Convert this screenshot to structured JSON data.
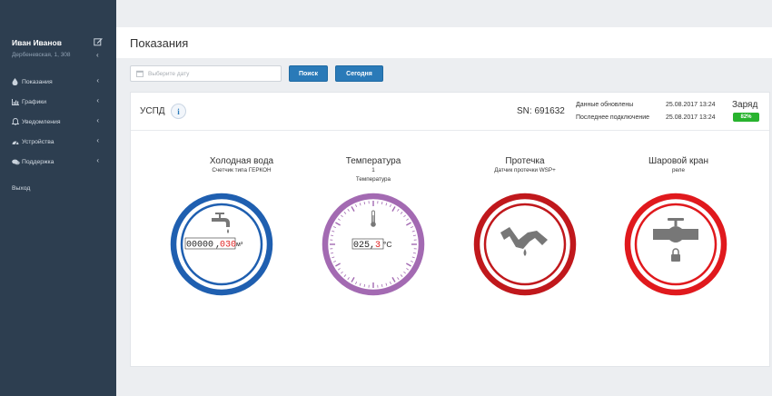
{
  "sidebar": {
    "user_name": "Иван Иванов",
    "address": "Дербеневская, 1, 308",
    "items": [
      {
        "label": "Показания",
        "icon": "drop-icon"
      },
      {
        "label": "Графики",
        "icon": "chart-icon"
      },
      {
        "label": "Уведомления",
        "icon": "bell-icon"
      },
      {
        "label": "Устройства",
        "icon": "dashboard-icon"
      },
      {
        "label": "Поддержка",
        "icon": "chat-icon"
      }
    ],
    "logout": "Выход"
  },
  "page": {
    "title": "Показания"
  },
  "filter": {
    "date_placeholder": "Выберите дату",
    "search_label": "Поиск",
    "today_label": "Сегодня"
  },
  "panel": {
    "title": "УСПД",
    "info_label": "i",
    "sn": "SN: 691632",
    "updated_label": "Данные обновлены",
    "updated_value": "25.08.2017 13:24",
    "last_conn_label": "Последнее подключение",
    "last_conn_value": "25.08.2017 13:24",
    "charge_label": "Заряд",
    "charge_value": "82%"
  },
  "gauges": [
    {
      "title": "Холодная вода",
      "subtitle": "Счетчик типа ГЕРКОН",
      "reading_black": "00000",
      "sep": ",",
      "reading_red": "030",
      "unit": "м³",
      "color": "#1f5fb0",
      "icon": "faucet-icon"
    },
    {
      "title": "Температура",
      "subtitle": "1",
      "subtitle2": "Температура",
      "reading_black": "025",
      "sep": ",",
      "reading_red": "3",
      "unit": "°C",
      "color": "#a36ab2",
      "icon": "thermometer-icon"
    },
    {
      "title": "Протечка",
      "subtitle": "Датчик протечки WSP+",
      "color": "#c0181c",
      "icon": "leak-pipe-icon"
    },
    {
      "title": "Шаровой кран",
      "subtitle": "реле",
      "color": "#e0191d",
      "icon": "ball-valve-lock-icon"
    }
  ]
}
